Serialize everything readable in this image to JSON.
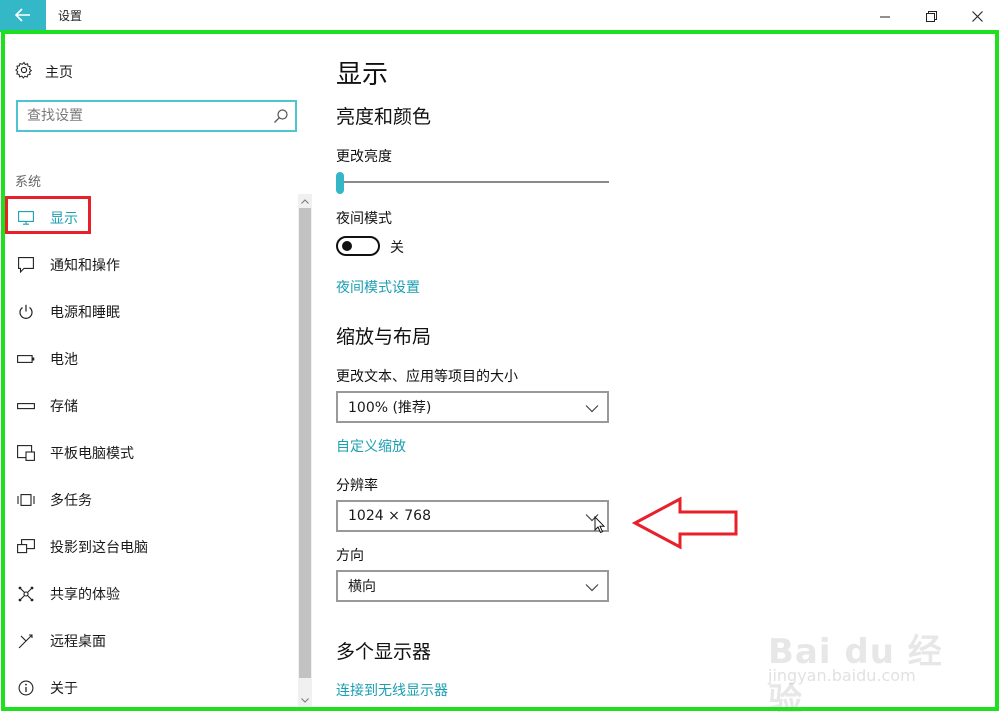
{
  "window": {
    "title": "设置",
    "accent": "#34b8c8",
    "link_color": "#1a9fb2"
  },
  "sidebar": {
    "home_label": "主页",
    "search_placeholder": "查找设置",
    "section_label": "系统",
    "items": [
      {
        "label": "显示",
        "icon": "monitor-icon",
        "active": true
      },
      {
        "label": "通知和操作",
        "icon": "notification-icon"
      },
      {
        "label": "电源和睡眠",
        "icon": "power-icon"
      },
      {
        "label": "电池",
        "icon": "battery-icon"
      },
      {
        "label": "存储",
        "icon": "storage-icon"
      },
      {
        "label": "平板电脑模式",
        "icon": "tablet-mode-icon"
      },
      {
        "label": "多任务",
        "icon": "multitask-icon"
      },
      {
        "label": "投影到这台电脑",
        "icon": "project-icon"
      },
      {
        "label": "共享的体验",
        "icon": "shared-experience-icon"
      },
      {
        "label": "远程桌面",
        "icon": "remote-desktop-icon"
      },
      {
        "label": "关于",
        "icon": "info-icon"
      }
    ]
  },
  "main": {
    "title": "显示",
    "brightness_section": "亮度和颜色",
    "brightness_label": "更改亮度",
    "brightness_value": 0,
    "night_mode_label": "夜间模式",
    "night_mode_state": "关",
    "night_mode_settings_link": "夜间模式设置",
    "scale_section": "缩放与布局",
    "scale_label": "更改文本、应用等项目的大小",
    "scale_value": "100% (推荐)",
    "custom_scale_link": "自定义缩放",
    "resolution_label": "分辨率",
    "resolution_value": "1024 × 768",
    "orientation_label": "方向",
    "orientation_value": "横向",
    "multi_display_section": "多个显示器",
    "wireless_display_link": "连接到无线显示器"
  },
  "watermark": {
    "text": "Bai du 经验",
    "sub": "jingyan.baidu.com"
  }
}
